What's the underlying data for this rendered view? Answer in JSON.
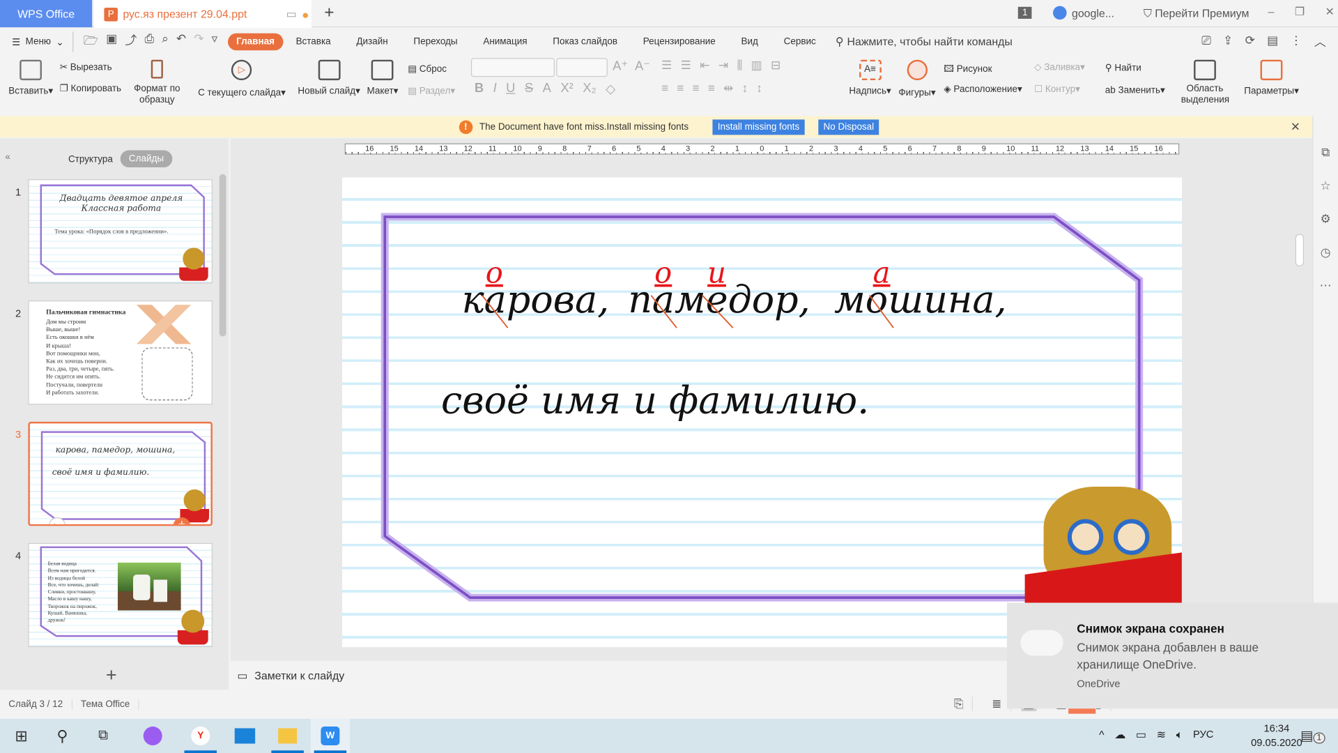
{
  "titlebar": {
    "app_tab": "WPS Office",
    "doc_tab": "рус.яз презент 29.04.ppt",
    "badge": "1",
    "account": "google...",
    "premium": "Перейти Премиум"
  },
  "menu": {
    "menu_label": "Меню",
    "tabs": [
      "Главная",
      "Вставка",
      "Дизайн",
      "Переходы",
      "Анимация",
      "Показ слайдов",
      "Рецензирование",
      "Вид",
      "Сервис"
    ],
    "active_tab": "Главная",
    "search_placeholder": "Нажмите, чтобы найти команды"
  },
  "ribbon": {
    "paste": "Вставить",
    "cut": "Вырезать",
    "copy": "Копировать",
    "format_painter": "Формат по образцу",
    "from_current": "С текущего слайда",
    "new_slide": "Новый слайд",
    "layout": "Макет",
    "reset": "Сброс",
    "section": "Раздел",
    "textbox": "Надпись",
    "shapes": "Фигуры",
    "picture": "Рисунок",
    "arrange": "Расположение",
    "fill": "Заливка",
    "outline": "Контур",
    "find": "Найти",
    "replace": "Заменить",
    "selection_pane": "Область выделения",
    "params": "Параметры"
  },
  "notification": {
    "message": "The Document have font miss.Install missing fonts",
    "install": "Install missing fonts",
    "dismiss": "No Disposal"
  },
  "panel": {
    "tabs": [
      "Структура",
      "Слайды"
    ],
    "active": "Слайды"
  },
  "ruler": {
    "labels": [
      "16",
      "15",
      "14",
      "13",
      "12",
      "11",
      "10",
      "9",
      "8",
      "7",
      "6",
      "5",
      "4",
      "3",
      "2",
      "1",
      "0",
      "1",
      "2",
      "3",
      "4",
      "5",
      "6",
      "7",
      "8",
      "9",
      "10",
      "11",
      "12",
      "13",
      "14",
      "15",
      "16"
    ]
  },
  "slides": [
    {
      "num": "1",
      "line1": "Двадцать девятое апреля",
      "line2": "Классная работа",
      "topic": "Тема урока: «Порядок слов в предложении»."
    },
    {
      "num": "2",
      "title": "Пальчиковая гимнастика",
      "lines": [
        "Дом мы строим",
        "Выше, выше!",
        "Есть окошки в нём",
        "И крыша!",
        "Вот помощники мои,",
        "Как их хочешь поверни.",
        "Раз, два, три, четыре, пять.",
        "Не сидится им опять.",
        "Постучали, повертели",
        "И работать захотели."
      ]
    },
    {
      "num": "3",
      "line1": "карова, памедор, мошина,",
      "line2": "своё имя и фамилию."
    },
    {
      "num": "4",
      "lines": [
        "Белая водица",
        "Всем нам пригодится.",
        "Из водицы белой",
        "Все, что хочешь, делай:",
        "Сливки, простоквашу,",
        "Масло в кашу нашу,",
        "Творожок на пирожок,",
        "Кушай, Ванюшка,",
        "дружок!"
      ]
    }
  ],
  "current_slide": {
    "words": [
      "карова,",
      "памедор,",
      "мошина,"
    ],
    "corrections": [
      "о",
      "о",
      "и",
      "а"
    ],
    "line2": "своё имя и фамилию."
  },
  "notes_placeholder": "Заметки к слайду",
  "status": {
    "slide": "Слайд 3 / 12",
    "theme": "Тема Office"
  },
  "toast": {
    "title": "Снимок экрана сохранен",
    "body": "Снимок экрана добавлен в ваше хранилище OneDrive.",
    "source": "OneDrive"
  },
  "tray": {
    "lang": "РУС",
    "time": "16:34",
    "date": "09.05.2020",
    "notif_count": "1"
  },
  "colors": {
    "accent": "#e9703e",
    "wps_blue": "#5b8def",
    "frame": "#7d4fc4",
    "correction": "#e8161a"
  }
}
